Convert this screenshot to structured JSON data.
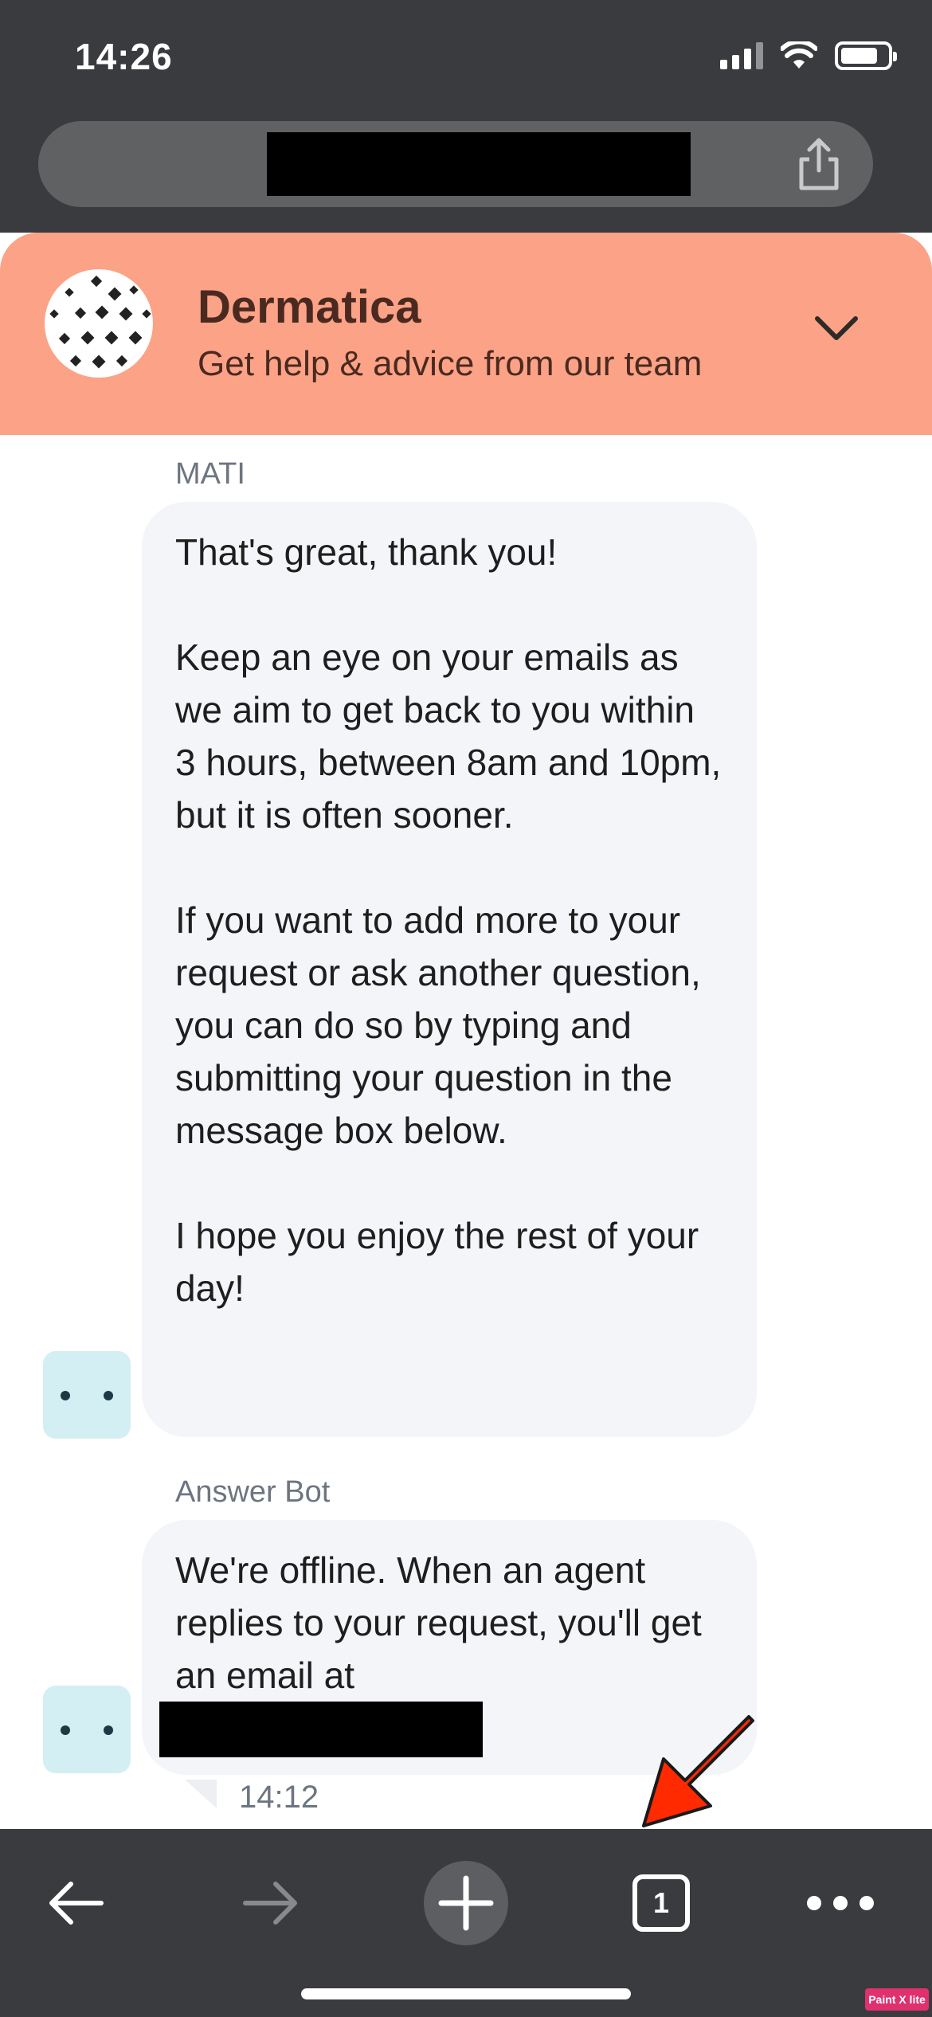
{
  "status_bar": {
    "time": "14:26"
  },
  "chat": {
    "header": {
      "title": "Dermatica",
      "subtitle": "Get help & advice from our team"
    },
    "messages": [
      {
        "sender": "MATI",
        "text": "That's great, thank you!\n\nKeep an eye on your emails as we aim to get back to you within 3 hours, between 8am and 10pm, but it is often sooner.\n\nIf you want to add more to your request or ask another question, you can do so by typing and submitting your question in the message box below.\n\nI hope you enjoy the rest of your day!"
      },
      {
        "sender": "Answer Bot",
        "text": "We're offline. When an agent replies to your request, you'll get an email at",
        "time": "14:12"
      }
    ]
  },
  "toolbar": {
    "tab_count": "1"
  },
  "watermark": "Paint X lite",
  "colors": {
    "chrome_bg": "#3a3b3e",
    "header_bg": "#fca286",
    "bubble_bg": "#f4f5f9",
    "bot_avatar_bg": "#d4eff3",
    "annotation_arrow": "#ff2a00"
  },
  "icons": {
    "share": "share-icon",
    "collapse": "chevron-down-icon",
    "back": "arrow-left-icon",
    "forward": "arrow-right-icon",
    "new_tab": "plus-circle-icon",
    "tabs": "tabs-icon",
    "menu": "more-horizontal-icon"
  }
}
